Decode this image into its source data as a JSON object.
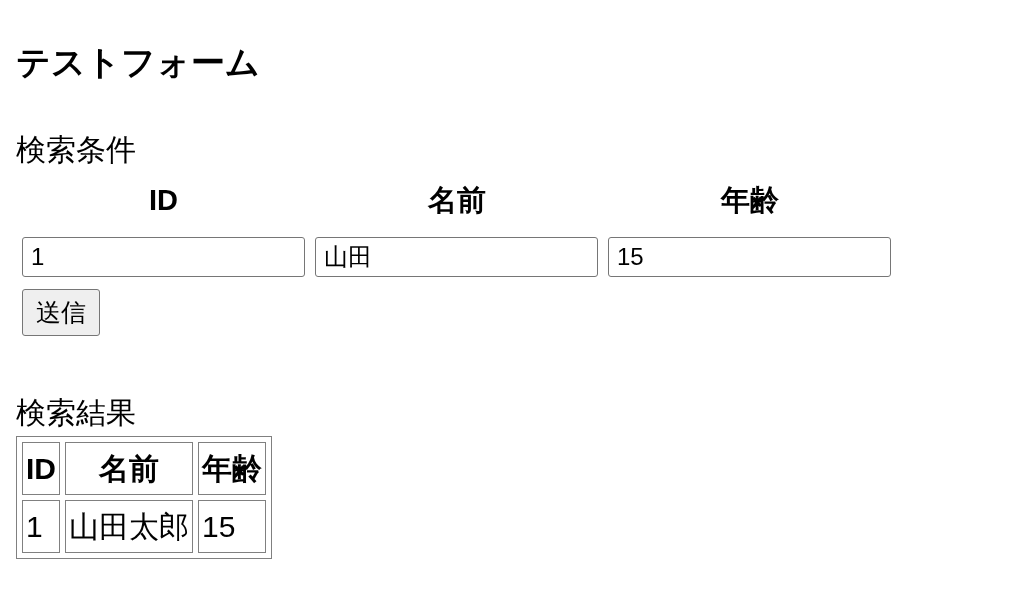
{
  "title": "テストフォーム",
  "search_form": {
    "heading": "検索条件",
    "fields": [
      {
        "label": "ID",
        "value": "1"
      },
      {
        "label": "名前",
        "value": "山田"
      },
      {
        "label": "年齢",
        "value": "15"
      }
    ],
    "submit_button": "送信"
  },
  "results": {
    "heading": "検索結果",
    "columns": [
      "ID",
      "名前",
      "年齢"
    ],
    "rows": [
      [
        "1",
        "山田太郎",
        "15"
      ]
    ]
  }
}
